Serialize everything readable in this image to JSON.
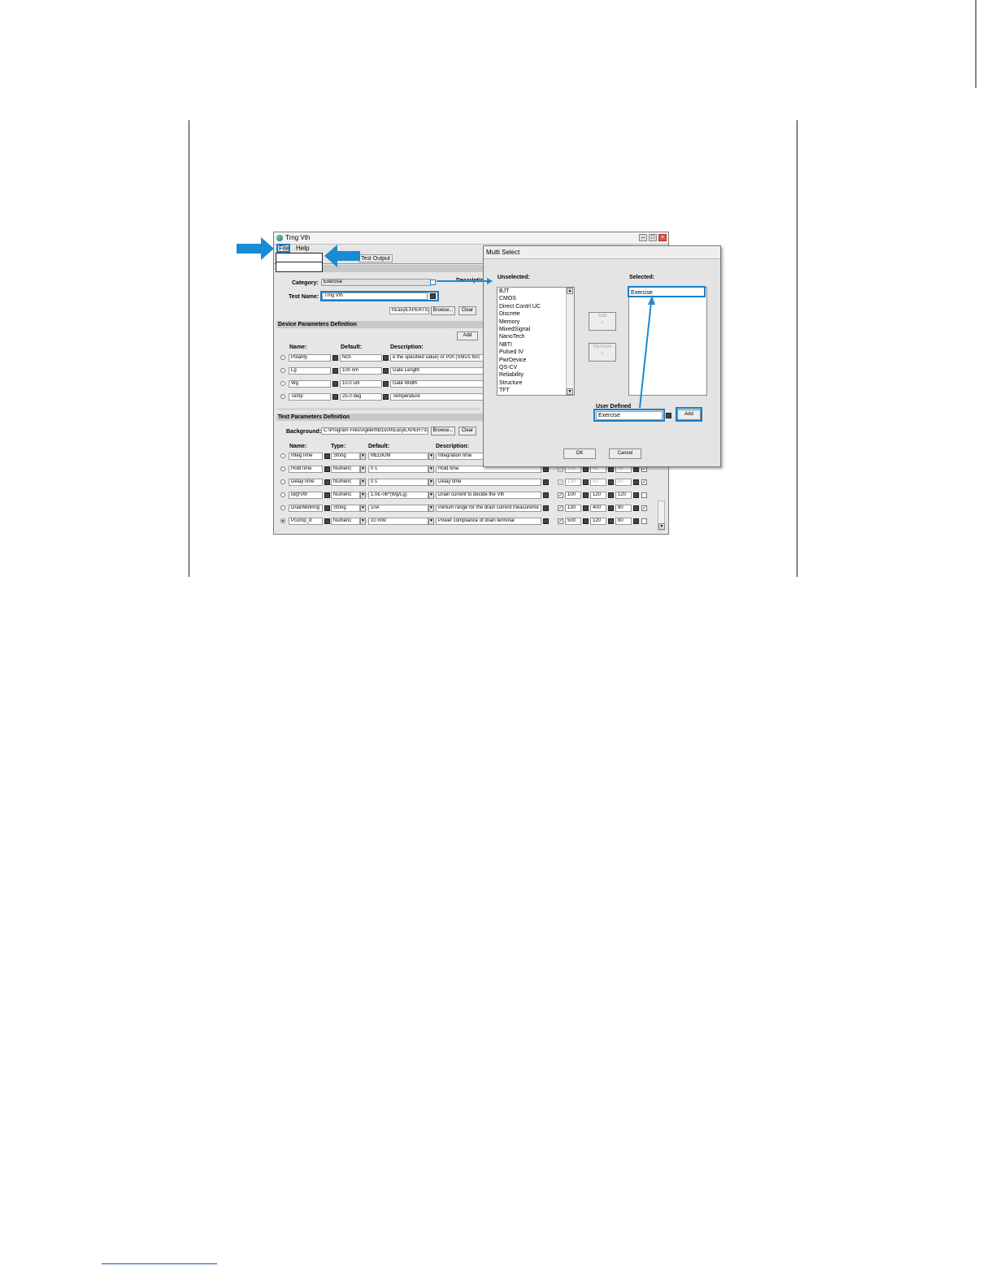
{
  "main_window": {
    "title": "Trng Vth",
    "menu": {
      "file": "File",
      "help": "Help"
    },
    "tabs": {
      "test_output": "Test Output"
    },
    "category_label": "Category:",
    "category_value": "Exercise",
    "description_label": "Descriptio",
    "test_name_label": "Test Name:",
    "test_name_value": "Trng Vth",
    "path_value": "t\\EasyEXPERT\\Gr",
    "browse_label": "Browse...",
    "clear_label": "Clear",
    "device_section": "Device Parameters Definition",
    "add_label": "Add",
    "device_columns": {
      "name": "Name:",
      "default": "Default:",
      "description": "Description:"
    },
    "device_rows": [
      {
        "name": "Polarity",
        "default": "Nch",
        "description": "e the specified value) or Pch (SMUs forc"
      },
      {
        "name": "Lg",
        "default": "100 nm",
        "description": "Gate Length"
      },
      {
        "name": "Wg",
        "default": "10.0 um",
        "description": "Gate Width"
      },
      {
        "name": "Temp",
        "default": "25.0 deg",
        "description": "Temperature"
      }
    ],
    "test_section": "Test Parameters Definition",
    "background_label": "Background:",
    "background_value": "C:\\Program Files\\Agilent\\B1500\\EasyEXPERT\\Gr",
    "test_columns": {
      "name": "Name:",
      "type": "Type:",
      "default": "Default:",
      "description": "Description:"
    },
    "test_rows": [
      {
        "name": "IntegTime",
        "type": "String",
        "default": "MEDIUM",
        "description": "Integration time",
        "v1": "",
        "v2": "",
        "v3": ""
      },
      {
        "name": "HoldTime",
        "type": "Numeric",
        "default": "0 s",
        "description": "Hold time",
        "v1": "100",
        "v2": "40",
        "v3": "40"
      },
      {
        "name": "DelayTime",
        "type": "Numeric",
        "default": "0 s",
        "description": "Delay time",
        "v1": "130",
        "v2": "50",
        "v3": "50"
      },
      {
        "name": "Id@Vth",
        "type": "Numeric",
        "default": "1.0E-06*(Wg/Lg)",
        "description": "Drain current to decide the Vth",
        "v1": "100",
        "v2": "120",
        "v3": "120"
      },
      {
        "name": "DrainMinRng",
        "type": "String",
        "default": "1nA",
        "description": "inimum range for the drain current measureme",
        "v1": "130",
        "v2": "400",
        "v3": "80"
      },
      {
        "name": "Pcomp_d",
        "type": "Numeric",
        "default": "10 mW",
        "description": "Power compliance of drain terminal",
        "v1": "500",
        "v2": "120",
        "v3": "80"
      }
    ]
  },
  "dialog": {
    "title": "Multi Select",
    "unselected_label": "Unselected:",
    "selected_label": "Selected:",
    "unselected_items": [
      "BJT",
      "CMOS",
      "Direct Contrl UC",
      "Discrete",
      "Memory",
      "MixedSignal",
      "NanoTech",
      "NBTI",
      "Pulsed IV",
      "PwrDevice",
      "QS-CV",
      "Reliability",
      "Structure",
      "TFT"
    ],
    "selected_items": [
      "Exercise"
    ],
    "add_arrow": "Add\n>",
    "remove_arrow": "Remove\n<",
    "user_defined_label": "User Defined",
    "user_defined_value": "Exercise",
    "add_label": "Add",
    "ok_label": "OK",
    "cancel_label": "Cancel"
  },
  "colors": {
    "highlight": "#1a7ec8",
    "arrow": "#1a8ad4"
  }
}
